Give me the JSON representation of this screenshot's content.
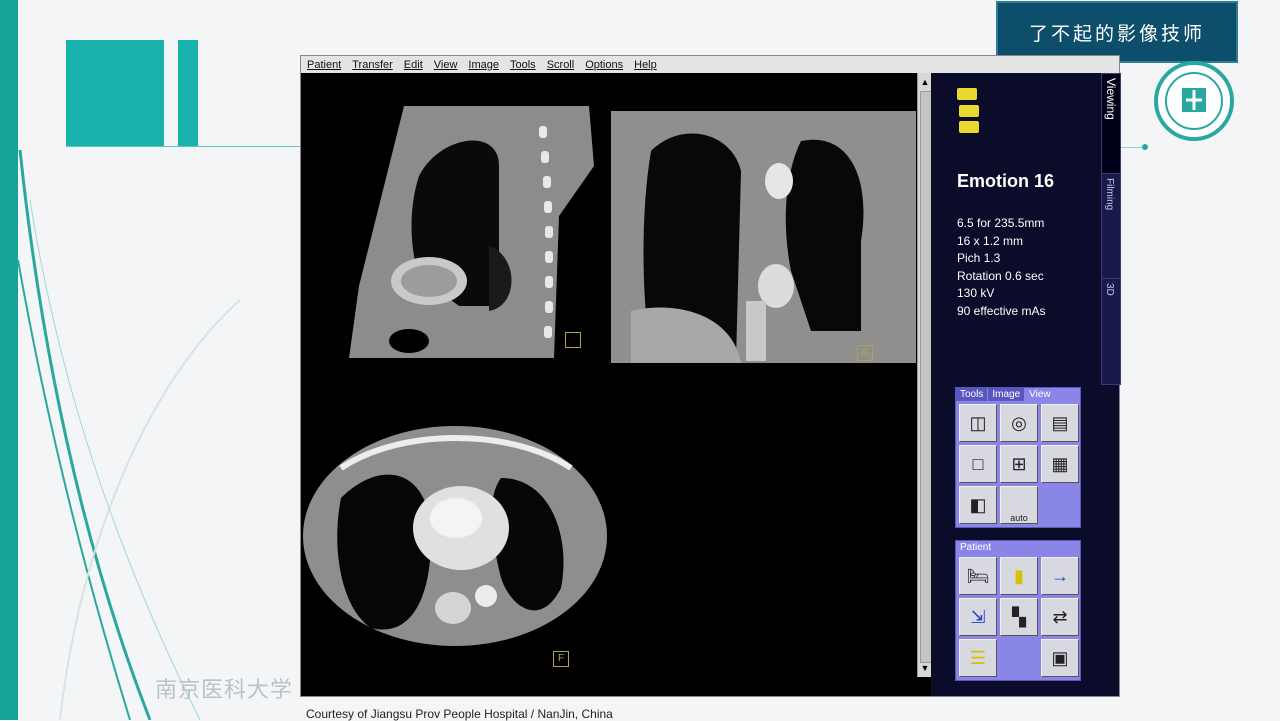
{
  "slide": {
    "brand_banner": "了不起的影像技师",
    "watermark": "南京医科大学",
    "caption": "Courtesy of Jiangsu Prov People Hospital / NanJin, China",
    "accent_color": "#17a39a"
  },
  "app": {
    "menu": [
      "Patient",
      "Transfer",
      "Edit",
      "View",
      "Image",
      "Tools",
      "Scroll",
      "Options",
      "Help"
    ],
    "viewports": [
      {
        "label": ""
      },
      {
        "label": "A"
      },
      {
        "label": "F"
      }
    ],
    "side_tabs": [
      "Viewing",
      "Filming",
      "3D"
    ],
    "system_name": "Emotion 16",
    "scan_params": [
      "6.5 for 235.5mm",
      "16 x 1.2 mm",
      "Pich 1.3",
      "Rotation 0.6 sec",
      "130 kV",
      "90 effective  mAs"
    ],
    "toolbox": {
      "tabs": [
        "Tools",
        "Image",
        "View"
      ],
      "active_tab": "View",
      "auto_label": "auto",
      "icons": [
        "compare-view-icon",
        "slice-view-icon",
        "volume-view-icon",
        "layout-1x1-icon",
        "layout-2x2-icon",
        "layout-3x3-icon",
        "layout-1x2-icon",
        "auto-layout-icon"
      ]
    },
    "patient_box": {
      "tab": "Patient",
      "icons": [
        "patient-browser-icon",
        "patient-series-icon",
        "transfer-series-icon",
        "load-images-icon",
        "checkerboard-icon",
        "compare-patients-icon",
        "list-icon",
        "film-icon"
      ]
    }
  }
}
